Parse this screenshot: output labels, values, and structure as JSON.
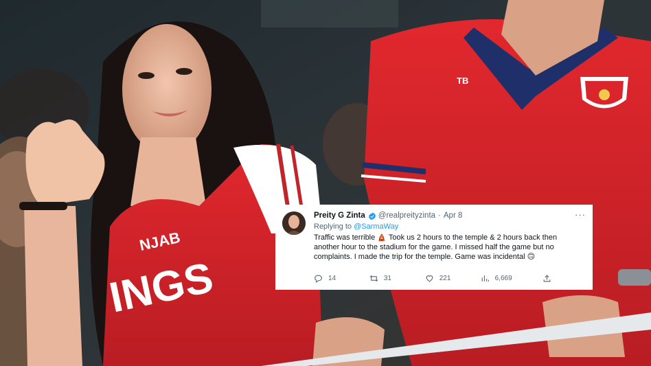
{
  "tweet": {
    "author_name": "Preity G Zinta",
    "handle": "@realpreityzinta",
    "date": "Apr 8",
    "separator": "·",
    "more_label": "···",
    "replying_prefix": "Replying to ",
    "replying_to": "@SarmaWay",
    "text_line1": "Traffic was terrible ",
    "text_emoji1": "🛕",
    "text_line1b": " Took us 2 hours to the temple & 2 hours back then",
    "text_line2": "another hour to the stadium for the game. I missed half the game but no",
    "text_line3": "complaints. I made the trip for the temple. Game was incidental ",
    "text_emoji2": "🙃",
    "reply_count": "14",
    "retweet_count": "31",
    "like_count": "221",
    "view_count": "6,669"
  },
  "photo": {
    "jersey_text_1": "NJAB",
    "jersey_text_2": "INGS",
    "shirt_logo": "PUNJAB KINGS",
    "chest_mark": "TB"
  },
  "colors": {
    "jersey_red": "#d9252b",
    "link_blue": "#1d9bf0",
    "muted_gray": "#536471"
  }
}
